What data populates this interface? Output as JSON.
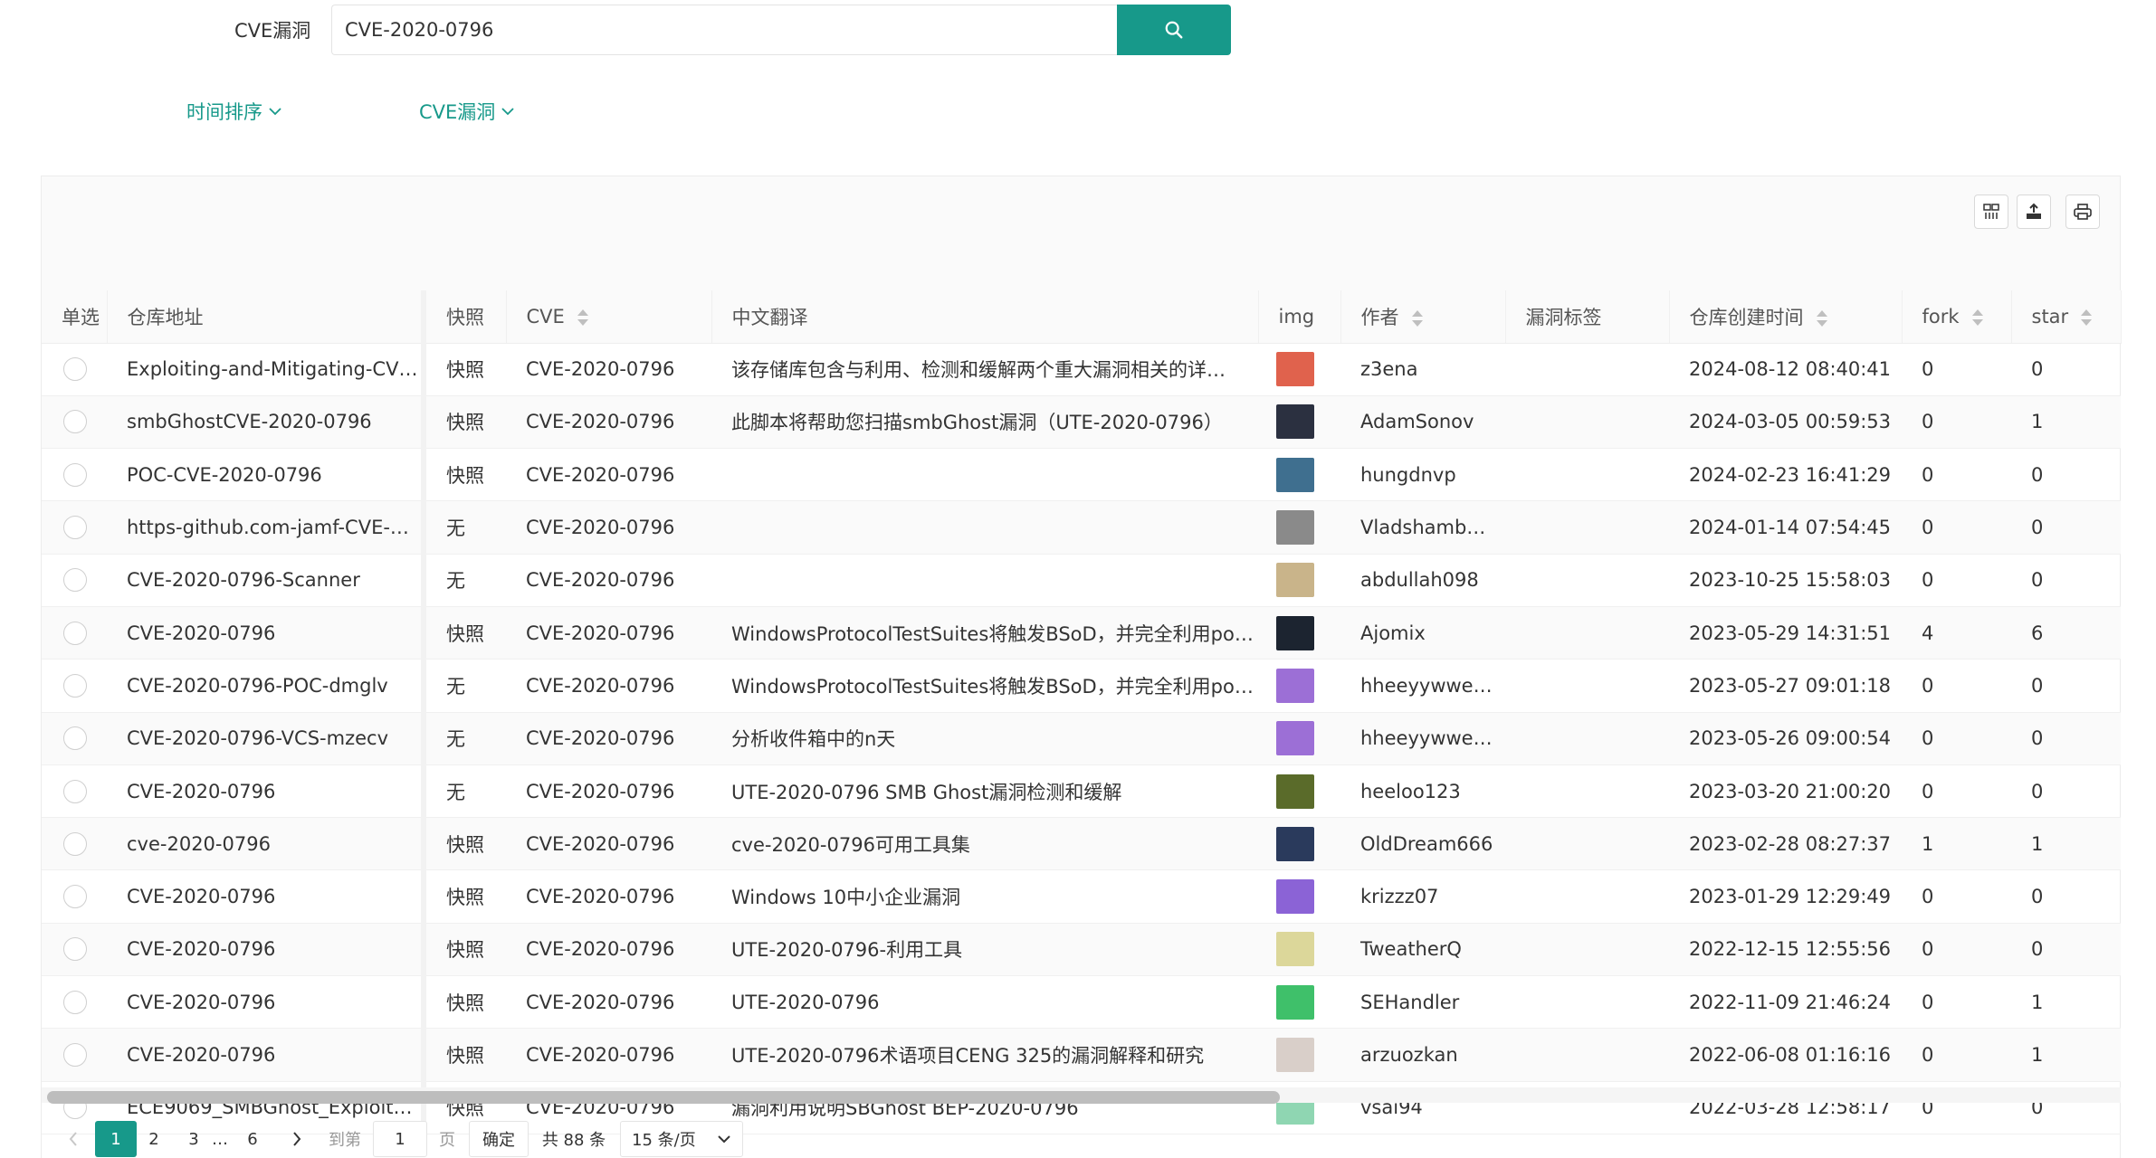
{
  "search": {
    "label": "CVE漏洞",
    "value": "CVE-2020-0796"
  },
  "filters": {
    "sort_label": "时间排序",
    "type_label": "CVE漏洞"
  },
  "columns": {
    "select": "单选",
    "repo": "仓库地址",
    "snapshot": "快照",
    "cve": "CVE",
    "translation": "中文翻译",
    "img": "img",
    "author": "作者",
    "tags": "漏洞标签",
    "created": "仓库创建时间",
    "fork": "fork",
    "star": "star"
  },
  "rows": [
    {
      "repo": "Exploiting-and-Mitigating-CV…",
      "snapshot": "快照",
      "cve": "CVE-2020-0796",
      "translation": "该存储库包含与利用、检测和缓解两个重大漏洞相关的详…",
      "author": "z3ena",
      "tags": "",
      "created": "2024-08-12 08:40:41",
      "fork": "0",
      "star": "0",
      "avatar": "#e0624d"
    },
    {
      "repo": "smbGhostCVE-2020-0796",
      "snapshot": "快照",
      "cve": "CVE-2020-0796",
      "translation": "此脚本将帮助您扫描smbGhost漏洞（UTE-2020-0796）",
      "author": "AdamSonov",
      "tags": "",
      "created": "2024-03-05 00:59:53",
      "fork": "0",
      "star": "1",
      "avatar": "#2b3040"
    },
    {
      "repo": "POC-CVE-2020-0796",
      "snapshot": "快照",
      "cve": "CVE-2020-0796",
      "translation": "",
      "author": "hungdnvp",
      "tags": "",
      "created": "2024-02-23 16:41:29",
      "fork": "0",
      "star": "0",
      "avatar": "#3f6f8f"
    },
    {
      "repo": "https-github.com-jamf-CVE-…",
      "snapshot": "无",
      "cve": "CVE-2020-0796",
      "translation": "",
      "author": "Vladshamb…",
      "tags": "",
      "created": "2024-01-14 07:54:45",
      "fork": "0",
      "star": "0",
      "avatar": "#8a8a8a"
    },
    {
      "repo": "CVE-2020-0796-Scanner",
      "snapshot": "无",
      "cve": "CVE-2020-0796",
      "translation": "",
      "author": "abdullah098",
      "tags": "",
      "created": "2023-10-25 15:58:03",
      "fork": "0",
      "star": "0",
      "avatar": "#c9b48a"
    },
    {
      "repo": "CVE-2020-0796",
      "snapshot": "快照",
      "cve": "CVE-2020-0796",
      "translation": "WindowsProtocolTestSuites将触发BSoD，并完全利用po…",
      "author": "Ajomix",
      "tags": "",
      "created": "2023-05-29 14:31:51",
      "fork": "4",
      "star": "6",
      "avatar": "#1c2430"
    },
    {
      "repo": "CVE-2020-0796-POC-dmglv",
      "snapshot": "无",
      "cve": "CVE-2020-0796",
      "translation": "WindowsProtocolTestSuites将触发BSoD，并完全利用po…",
      "author": "hheeyywwe…",
      "tags": "",
      "created": "2023-05-27 09:01:18",
      "fork": "0",
      "star": "0",
      "avatar": "#9c6fd6"
    },
    {
      "repo": "CVE-2020-0796-VCS-mzecv",
      "snapshot": "无",
      "cve": "CVE-2020-0796",
      "translation": "分析收件箱中的n天",
      "author": "hheeyywwe…",
      "tags": "",
      "created": "2023-05-26 09:00:54",
      "fork": "0",
      "star": "0",
      "avatar": "#9c6fd6"
    },
    {
      "repo": "CVE-2020-0796",
      "snapshot": "无",
      "cve": "CVE-2020-0796",
      "translation": "UTE-2020-0796 SMB Ghost漏洞检测和缓解",
      "author": "heeloo123",
      "tags": "",
      "created": "2023-03-20 21:00:20",
      "fork": "0",
      "star": "0",
      "avatar": "#5a6b2a"
    },
    {
      "repo": "cve-2020-0796",
      "snapshot": "快照",
      "cve": "CVE-2020-0796",
      "translation": "cve-2020-0796可用工具集",
      "author": "OldDream666",
      "tags": "",
      "created": "2023-02-28 08:27:37",
      "fork": "1",
      "star": "1",
      "avatar": "#2a3a5c"
    },
    {
      "repo": "CVE-2020-0796",
      "snapshot": "快照",
      "cve": "CVE-2020-0796",
      "translation": "Windows 10中小企业漏洞",
      "author": "krizzz07",
      "tags": "",
      "created": "2023-01-29 12:29:49",
      "fork": "0",
      "star": "0",
      "avatar": "#8b63d6"
    },
    {
      "repo": "CVE-2020-0796",
      "snapshot": "快照",
      "cve": "CVE-2020-0796",
      "translation": "UTE-2020-0796-利用工具",
      "author": "TweatherQ",
      "tags": "",
      "created": "2022-12-15 12:55:56",
      "fork": "0",
      "star": "0",
      "avatar": "#dcd79a"
    },
    {
      "repo": "CVE-2020-0796",
      "snapshot": "快照",
      "cve": "CVE-2020-0796",
      "translation": "UTE-2020-0796",
      "author": "SEHandler",
      "tags": "",
      "created": "2022-11-09 21:46:24",
      "fork": "0",
      "star": "1",
      "avatar": "#3fc06a"
    },
    {
      "repo": "CVE-2020-0796",
      "snapshot": "快照",
      "cve": "CVE-2020-0796",
      "translation": "UTE-2020-0796术语项目CENG 325的漏洞解释和研究",
      "author": "arzuozkan",
      "tags": "",
      "created": "2022-06-08 01:16:16",
      "fork": "0",
      "star": "1",
      "avatar": "#d9cfc9"
    },
    {
      "repo": "ECE9069_SMBGhost_Exploit…",
      "snapshot": "快照",
      "cve": "CVE-2020-0796",
      "translation": "漏洞利用说明SBGhost BEP-2020-0796",
      "author": "vsai94",
      "tags": "",
      "created": "2022-03-28 12:58:17",
      "fork": "0",
      "star": "0",
      "avatar": "#8fd6b2"
    }
  ],
  "pagination": {
    "pages": [
      "1",
      "2",
      "3",
      "…",
      "6"
    ],
    "goto_label": "到第",
    "goto_value": "1",
    "page_unit": "页",
    "confirm": "确定",
    "total": "共 88 条",
    "page_size": "15 条/页"
  },
  "colors": {
    "accent": "#17998a"
  }
}
